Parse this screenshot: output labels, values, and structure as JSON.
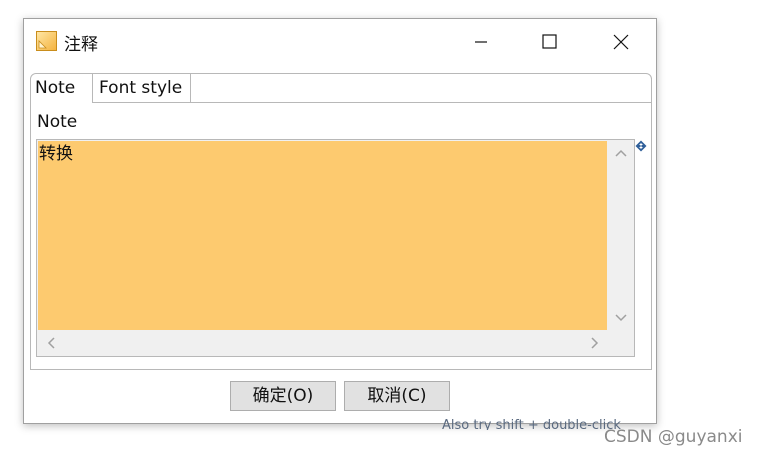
{
  "window": {
    "title": "注释",
    "icon": "note-app-icon",
    "controls": [
      "minimize-icon",
      "maximize-icon",
      "close-icon"
    ]
  },
  "tabs": [
    {
      "label": "Note",
      "active": true
    },
    {
      "label": "Font  style",
      "active": false
    }
  ],
  "note": {
    "label": "Note",
    "text": "转换",
    "background_color": "#fdca6f"
  },
  "buttons": {
    "ok": "确定(O)",
    "cancel": "取消(C)"
  },
  "hint": "Also try shift + double-click",
  "watermark": "CSDN @guyanxi"
}
